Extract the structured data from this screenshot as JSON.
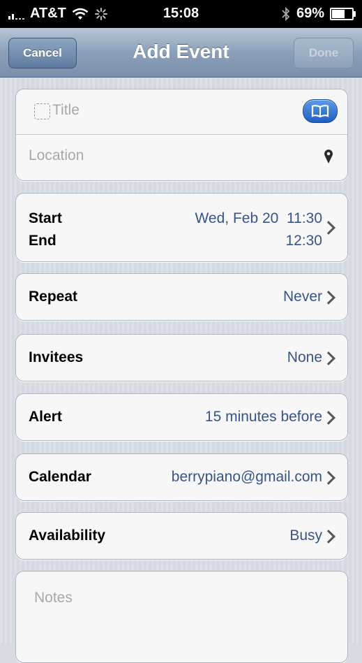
{
  "status_bar": {
    "carrier": "AT&T",
    "time": "15:08",
    "battery_text": "69%",
    "battery_level": 0.69
  },
  "nav": {
    "cancel_label": "Cancel",
    "title": "Add Event",
    "done_label": "Done"
  },
  "event": {
    "title_placeholder": "Title",
    "location_placeholder": "Location",
    "start_label": "Start",
    "end_label": "End",
    "start_date": "Wed, Feb 20",
    "start_time": "11:30",
    "end_time": "12:30",
    "repeat_label": "Repeat",
    "repeat_value": "Never",
    "invitees_label": "Invitees",
    "invitees_value": "None",
    "alert_label": "Alert",
    "alert_value": "15 minutes before",
    "calendar_label": "Calendar",
    "calendar_value": "berrypiano@gmail.com",
    "availability_label": "Availability",
    "availability_value": "Busy",
    "notes_placeholder": "Notes"
  },
  "colors": {
    "value_blue": "#385487",
    "nav_bar": "#8aa0ba",
    "placeholder_gray": "#a8a8a8"
  },
  "icons": [
    "signal-icon",
    "wifi-icon",
    "activity-icon",
    "bluetooth-icon",
    "battery-icon",
    "contacts-book-icon",
    "location-pin-icon",
    "chevron-right-icon"
  ]
}
